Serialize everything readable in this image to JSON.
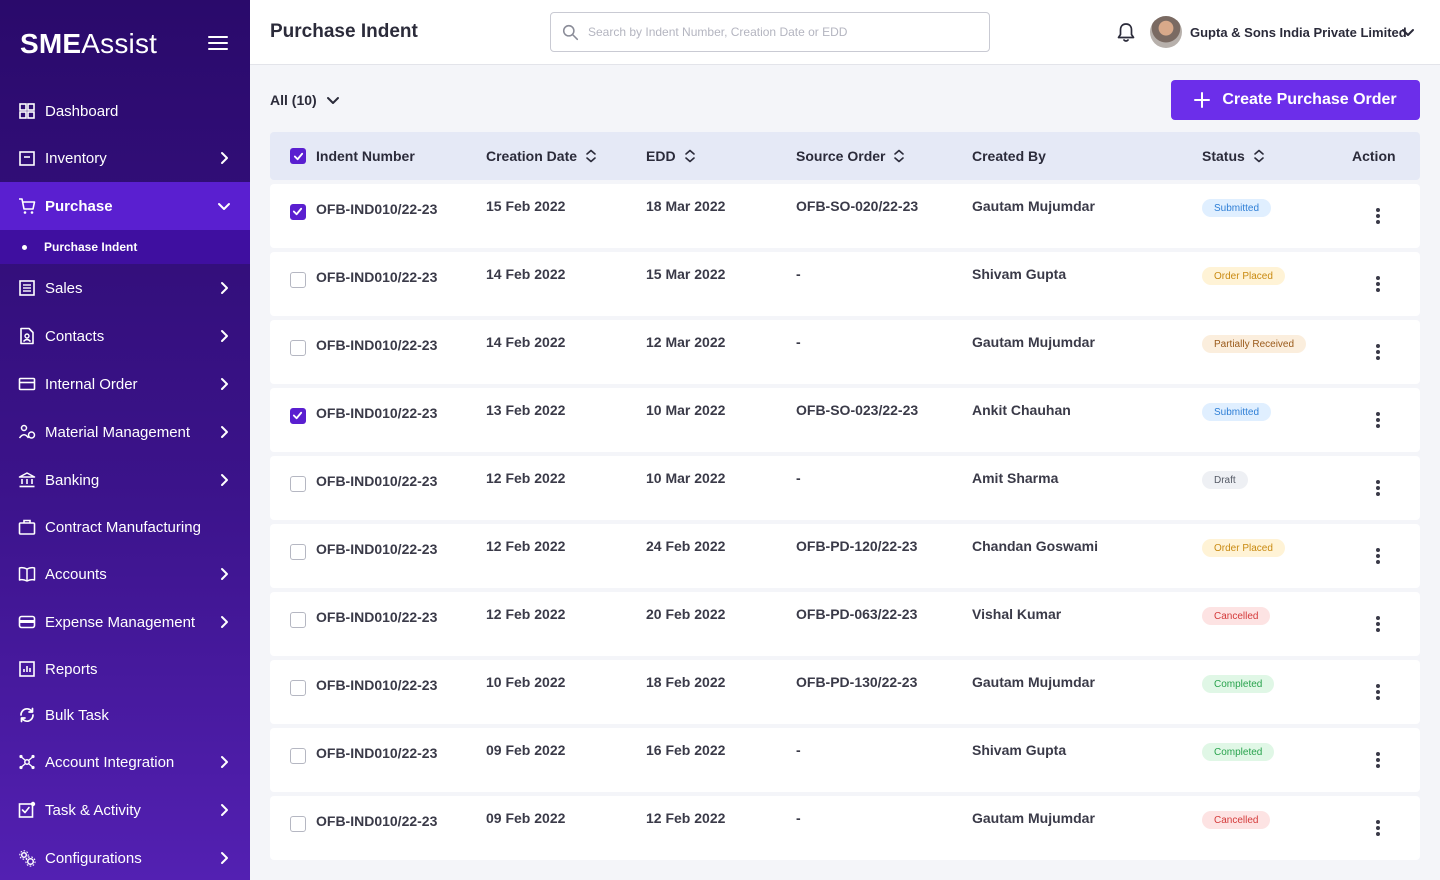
{
  "app": {
    "logo_strong": "SME",
    "logo_rest": "Assist"
  },
  "sidebar": {
    "items": [
      {
        "label": "Dashboard",
        "icon": "dashboard-icon",
        "has_chevron": false
      },
      {
        "label": "Inventory",
        "icon": "inventory-icon",
        "has_chevron": true
      },
      {
        "label": "Purchase",
        "icon": "cart-icon",
        "has_chevron": true,
        "expanded": true,
        "active": true
      },
      {
        "label": "Sales",
        "icon": "sales-icon",
        "has_chevron": true
      },
      {
        "label": "Contacts",
        "icon": "contacts-icon",
        "has_chevron": true
      },
      {
        "label": "Internal Order",
        "icon": "internal-order-icon",
        "has_chevron": true
      },
      {
        "label": "Material Management",
        "icon": "material-management-icon",
        "has_chevron": true
      },
      {
        "label": "Banking",
        "icon": "bank-icon",
        "has_chevron": true
      },
      {
        "label": "Contract Manufacturing",
        "icon": "briefcase-icon",
        "has_chevron": false
      },
      {
        "label": "Accounts",
        "icon": "book-icon",
        "has_chevron": true
      },
      {
        "label": "Expense Management",
        "icon": "wallet-icon",
        "has_chevron": true
      },
      {
        "label": "Reports",
        "icon": "reports-icon",
        "has_chevron": false
      },
      {
        "label": "Bulk Task",
        "icon": "refresh-icon",
        "has_chevron": false
      },
      {
        "label": "Account Integration",
        "icon": "network-icon",
        "has_chevron": true
      },
      {
        "label": "Task & Activity",
        "icon": "task-icon",
        "has_chevron": true
      },
      {
        "label": "Configurations",
        "icon": "settings-icon",
        "has_chevron": true
      }
    ],
    "sub_item": "Purchase Indent"
  },
  "header": {
    "title": "Purchase Indent",
    "search_placeholder": "Search by Indent Number, Creation Date or EDD",
    "company": "Gupta & Sons India Private Limited"
  },
  "toolbar": {
    "filter_label": "All (10)",
    "create_label": "Create Purchase Order"
  },
  "table": {
    "columns": [
      "Indent Number",
      "Creation Date",
      "EDD",
      "Source Order",
      "Created By",
      "Status",
      "Action"
    ],
    "rows": [
      {
        "checked": true,
        "indent": "OFB-IND010/22-23",
        "created": "15 Feb 2022",
        "edd": "18 Mar 2022",
        "source": "OFB-SO-020/22-23",
        "by": "Gautam Mujumdar",
        "status": "Submitted",
        "status_kind": "submitted"
      },
      {
        "checked": false,
        "indent": "OFB-IND010/22-23",
        "created": "14 Feb 2022",
        "edd": "15 Mar 2022",
        "source": "-",
        "by": "Shivam Gupta",
        "status": "Order Placed",
        "status_kind": "placed"
      },
      {
        "checked": false,
        "indent": "OFB-IND010/22-23",
        "created": "14 Feb 2022",
        "edd": "12 Mar 2022",
        "source": "-",
        "by": "Gautam Mujumdar",
        "status": "Partially Received",
        "status_kind": "partial"
      },
      {
        "checked": true,
        "indent": "OFB-IND010/22-23",
        "created": "13 Feb 2022",
        "edd": "10 Mar 2022",
        "source": "OFB-SO-023/22-23",
        "by": "Ankit Chauhan",
        "status": "Submitted",
        "status_kind": "submitted"
      },
      {
        "checked": false,
        "indent": "OFB-IND010/22-23",
        "created": "12 Feb 2022",
        "edd": "10 Mar 2022",
        "source": "-",
        "by": "Amit Sharma",
        "status": "Draft",
        "status_kind": "draft"
      },
      {
        "checked": false,
        "indent": "OFB-IND010/22-23",
        "created": "12 Feb 2022",
        "edd": "24 Feb 2022",
        "source": "OFB-PD-120/22-23",
        "by": "Chandan Goswami",
        "status": "Order Placed",
        "status_kind": "placed"
      },
      {
        "checked": false,
        "indent": "OFB-IND010/22-23",
        "created": "12 Feb 2022",
        "edd": "20 Feb 2022",
        "source": "OFB-PD-063/22-23",
        "by": "Vishal Kumar",
        "status": "Cancelled",
        "status_kind": "cancelled"
      },
      {
        "checked": false,
        "indent": "OFB-IND010/22-23",
        "created": "10 Feb 2022",
        "edd": "18 Feb 2022",
        "source": "OFB-PD-130/22-23",
        "by": "Gautam Mujumdar",
        "status": "Completed",
        "status_kind": "completed"
      },
      {
        "checked": false,
        "indent": "OFB-IND010/22-23",
        "created": "09 Feb 2022",
        "edd": "16 Feb 2022",
        "source": "-",
        "by": "Shivam Gupta",
        "status": "Completed",
        "status_kind": "completed"
      },
      {
        "checked": false,
        "indent": "OFB-IND010/22-23",
        "created": "09 Feb 2022",
        "edd": "12 Feb 2022",
        "source": "-",
        "by": "Gautam Mujumdar",
        "status": "Cancelled",
        "status_kind": "cancelled"
      }
    ]
  },
  "colors": {
    "accent": "#6c2eea",
    "sidebar_top": "#2a0a6b",
    "sidebar_bottom": "#5320b2",
    "status": {
      "submitted": {
        "bg": "#e0efff",
        "fg": "#2f7fd6"
      },
      "placed": {
        "bg": "#fff3d6",
        "fg": "#c98a11"
      },
      "partial": {
        "bg": "#fbeedd",
        "fg": "#9a5a1a"
      },
      "draft": {
        "bg": "#eef0f4",
        "fg": "#555a66"
      },
      "cancelled": {
        "bg": "#fde3e3",
        "fg": "#d43a3a"
      },
      "completed": {
        "bg": "#e0f7e6",
        "fg": "#29a34d"
      }
    }
  }
}
